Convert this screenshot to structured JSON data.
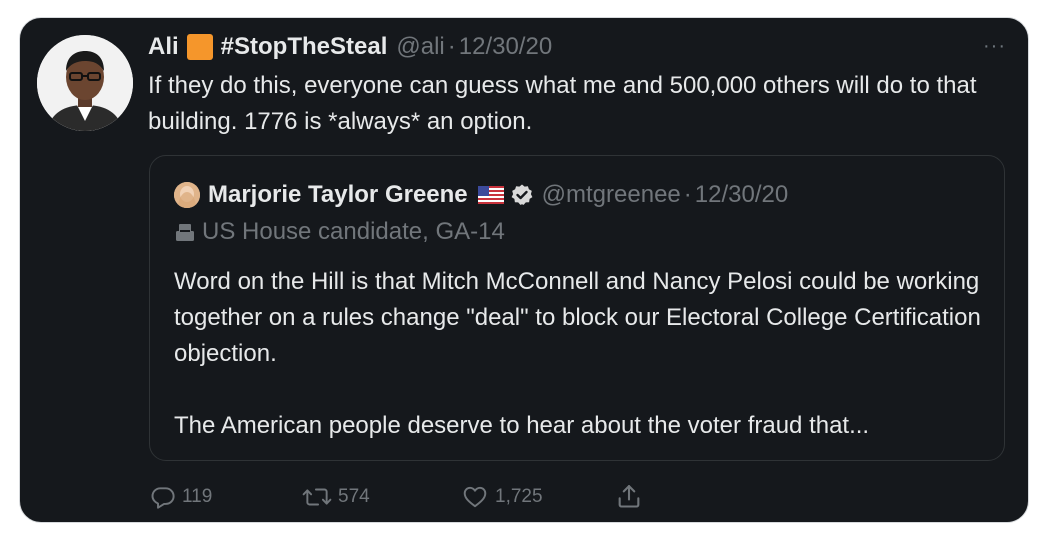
{
  "tweet": {
    "author_name": "Ali",
    "author_tag": "#StopTheSteal",
    "author_handle": "@ali",
    "separator": "·",
    "date": "12/30/20",
    "more_label": "···",
    "text": "If they do this, everyone can guess what me and 500,000 others will do to that building. 1776 is *always* an option."
  },
  "quote": {
    "author_name": "Marjorie Taylor Greene",
    "author_handle": "@mtgreenee",
    "separator": "·",
    "date": "12/30/20",
    "label": "US House candidate, GA-14",
    "text": "Word on the Hill is that Mitch McConnell and Nancy Pelosi could be working together on a rules change \"deal\" to block our Electoral College Certification objection.\n\nThe American people deserve to hear about the voter fraud that..."
  },
  "actions": {
    "replies": "119",
    "retweets": "574",
    "likes": "1,725"
  },
  "colors": {
    "background": "#15181c",
    "text": "#e7e9ea",
    "muted": "#71767b",
    "accent_square": "#f5962b"
  },
  "icons": [
    "more-icon",
    "orange-square-icon",
    "us-flag-icon",
    "verified-badge-icon",
    "ballot-box-icon",
    "reply-icon",
    "retweet-icon",
    "like-icon",
    "share-icon"
  ]
}
